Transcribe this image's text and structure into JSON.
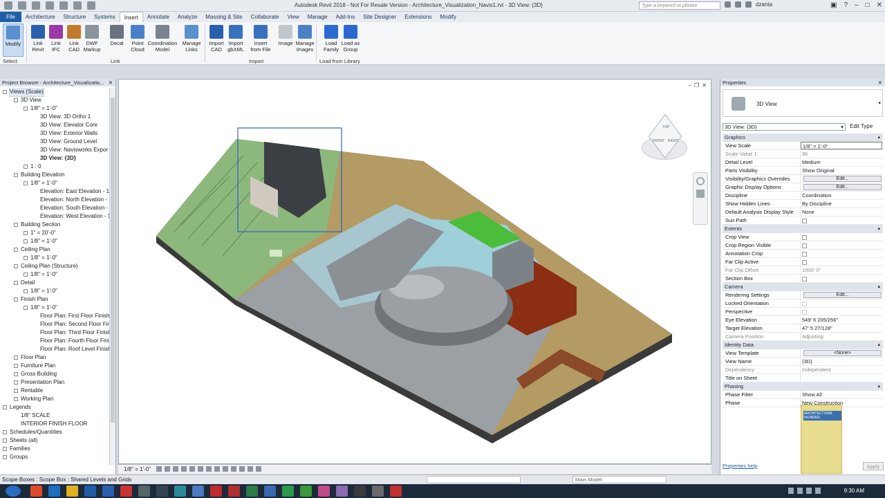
{
  "window": {
    "title": "Autodesk Revit 2018 - Not For Resale Version -    Architecture_Visualization_Navis1.rvt - 3D View: {3D}",
    "search_placeholder": "Type a keyword or phrase",
    "user": "dzanta"
  },
  "tabs": [
    "File",
    "Architecture",
    "Structure",
    "Systems",
    "Insert",
    "Annotate",
    "Analyze",
    "Massing & Site",
    "Collaborate",
    "View",
    "Manage",
    "Add-Ins",
    "Site Designer",
    "Extensions",
    "Modify"
  ],
  "active_tab": "Insert",
  "ribbon": {
    "buttons": [
      {
        "label": "Modify",
        "color": "#5a8fd0"
      },
      {
        "label": "Link\nRevit",
        "color": "#2a5fb0"
      },
      {
        "label": "Link\nIFC",
        "color": "#9a3aa8"
      },
      {
        "label": "Link\nCAD",
        "color": "#c07a2a"
      },
      {
        "label": "DWF\nMarkup",
        "color": "#8a949e"
      },
      {
        "label": "Decal",
        "color": "#6a7480"
      },
      {
        "label": "Point\nCloud",
        "color": "#4a80c8"
      },
      {
        "label": "Coordination\nModel",
        "color": "#7a8490"
      },
      {
        "label": "Manage\nLinks",
        "color": "#5a8fd0"
      },
      {
        "label": "Import\nCAD",
        "color": "#2a5fb0"
      },
      {
        "label": "Import\ngbXML",
        "color": "#3a70c0"
      },
      {
        "label": "Insert\nfrom File",
        "color": "#3a70c0"
      },
      {
        "label": "Image",
        "color": "#c0c6cc"
      },
      {
        "label": "Manage\nImages",
        "color": "#4a80c8"
      },
      {
        "label": "Load\nFamily",
        "color": "#2a6ad0"
      },
      {
        "label": "Load as\nGroup",
        "color": "#2a6ad0"
      }
    ],
    "panels": [
      "Select",
      "Link",
      "Import",
      "Load from Library"
    ]
  },
  "project_browser": {
    "title": "Project Browser - Architecture_Visualizatio...",
    "items": [
      {
        "label": "Views (Scale)",
        "lvl": 0,
        "pm": "-",
        "sel": true
      },
      {
        "label": "3D View",
        "lvl": 1,
        "pm": "-"
      },
      {
        "label": "1/8\" = 1'-0\"",
        "lvl": 2,
        "pm": "-"
      },
      {
        "label": "3D View: 3D Ortho 1",
        "lvl": 3
      },
      {
        "label": "3D View: Elevator Core",
        "lvl": 3
      },
      {
        "label": "3D View: Exterior Walls",
        "lvl": 3
      },
      {
        "label": "3D View: Ground Level",
        "lvl": 3
      },
      {
        "label": "3D View: Navisworks Expor",
        "lvl": 3
      },
      {
        "label": "3D View: {3D}",
        "lvl": 3,
        "bold": true
      },
      {
        "label": "1 : 0",
        "lvl": 2,
        "pm": "+"
      },
      {
        "label": "Building Elevation",
        "lvl": 1,
        "pm": "-"
      },
      {
        "label": "1/8\" = 1'-0\"",
        "lvl": 2,
        "pm": "-"
      },
      {
        "label": "Elevation: East Elevation - 1",
        "lvl": 3
      },
      {
        "label": "Elevation: North Elevation -",
        "lvl": 3
      },
      {
        "label": "Elevation: South Elevation -",
        "lvl": 3
      },
      {
        "label": "Elevation: West Elevation - 1",
        "lvl": 3
      },
      {
        "label": "Building Section",
        "lvl": 1,
        "pm": "-"
      },
      {
        "label": "1\" = 20'-0\"",
        "lvl": 2,
        "pm": "+"
      },
      {
        "label": "1/8\" = 1'-0\"",
        "lvl": 2,
        "pm": "+"
      },
      {
        "label": "Ceiling Plan",
        "lvl": 1,
        "pm": "-"
      },
      {
        "label": "1/8\" = 1'-0\"",
        "lvl": 2,
        "pm": "+"
      },
      {
        "label": "Ceiling Plan (Structure)",
        "lvl": 1,
        "pm": "-"
      },
      {
        "label": "1/8\" = 1'-0\"",
        "lvl": 2,
        "pm": "+"
      },
      {
        "label": "Detail",
        "lvl": 1,
        "pm": "-"
      },
      {
        "label": "1/8\" = 1'-0\"",
        "lvl": 2,
        "pm": "+"
      },
      {
        "label": "Finish Plan",
        "lvl": 1,
        "pm": "-"
      },
      {
        "label": "1/8\" = 1'-0\"",
        "lvl": 2,
        "pm": "-"
      },
      {
        "label": "Floor Plan: First Floor Finish",
        "lvl": 3
      },
      {
        "label": "Floor Plan: Second Floor Fin",
        "lvl": 3
      },
      {
        "label": "Floor Plan: Third Floor Finish",
        "lvl": 3
      },
      {
        "label": "Floor Plan: Fourth Floor Fini",
        "lvl": 3
      },
      {
        "label": "Floor Plan: Roof Level Finish",
        "lvl": 3
      },
      {
        "label": "Floor Plan",
        "lvl": 1,
        "pm": "+"
      },
      {
        "label": "Furniture Plan",
        "lvl": 1,
        "pm": "+"
      },
      {
        "label": "Gross Building",
        "lvl": 1,
        "pm": "+"
      },
      {
        "label": "Presentation Plan",
        "lvl": 1,
        "pm": "+"
      },
      {
        "label": "Rentable",
        "lvl": 1,
        "pm": "+"
      },
      {
        "label": "Working Plan",
        "lvl": 1,
        "pm": "+"
      },
      {
        "label": "Legends",
        "lvl": 0,
        "pm": "-"
      },
      {
        "label": "1/8\" SCALE",
        "lvl": 1
      },
      {
        "label": "INTERIOR FINISH FLOOR",
        "lvl": 1
      },
      {
        "label": "Schedules/Quantities",
        "lvl": 0,
        "pm": "+"
      },
      {
        "label": "Sheets (all)",
        "lvl": 0,
        "pm": "+"
      },
      {
        "label": "Families",
        "lvl": 0,
        "pm": "+"
      },
      {
        "label": "Groups",
        "lvl": 0,
        "pm": "+"
      }
    ]
  },
  "view": {
    "scale": "1/8\" = 1'-0\"",
    "viewcube": {
      "top": "TOP",
      "front": "FRONT",
      "right": "RIGHT"
    }
  },
  "properties": {
    "title": "Properties",
    "type_name": "3D View",
    "selector": "3D View: {3D}",
    "edit_type": "Edit Type",
    "sections": [
      {
        "name": "Graphics",
        "rows": [
          {
            "k": "View Scale",
            "v": "1/8\" = 1'-0\"",
            "t": "inp"
          },
          {
            "k": "Scale Value    1:",
            "v": "96",
            "t": "dis"
          },
          {
            "k": "Detail Level",
            "v": "Medium"
          },
          {
            "k": "Parts Visibility",
            "v": "Show Original"
          },
          {
            "k": "Visibility/Graphics Overrides",
            "v": "Edit...",
            "t": "btn"
          },
          {
            "k": "Graphic Display Options",
            "v": "Edit...",
            "t": "btn"
          },
          {
            "k": "Discipline",
            "v": "Coordination"
          },
          {
            "k": "Show Hidden Lines",
            "v": "By Discipline"
          },
          {
            "k": "Default Analysis Display Style",
            "v": "None"
          },
          {
            "k": "Sun Path",
            "v": "",
            "t": "cb"
          }
        ]
      },
      {
        "name": "Extents",
        "rows": [
          {
            "k": "Crop View",
            "v": "",
            "t": "cb"
          },
          {
            "k": "Crop Region Visible",
            "v": "",
            "t": "cb"
          },
          {
            "k": "Annotation Crop",
            "v": "",
            "t": "cb"
          },
          {
            "k": "Far Clip Active",
            "v": "",
            "t": "cb"
          },
          {
            "k": "Far Clip Offset",
            "v": "1000'  0\"",
            "t": "dis"
          },
          {
            "k": "Section Box",
            "v": "",
            "t": "cb"
          }
        ]
      },
      {
        "name": "Camera",
        "rows": [
          {
            "k": "Rendering Settings",
            "v": "Edit...",
            "t": "btn"
          },
          {
            "k": "Locked Orientation",
            "v": "",
            "t": "cbd"
          },
          {
            "k": "Perspective",
            "v": "",
            "t": "cbd"
          },
          {
            "k": "Eye Elevation",
            "v": "549'  6 205/256\""
          },
          {
            "k": "Target Elevation",
            "v": "47'  5 27/128\""
          },
          {
            "k": "Camera Position",
            "v": "Adjusting",
            "t": "dis"
          }
        ]
      },
      {
        "name": "Identity Data",
        "rows": [
          {
            "k": "View Template",
            "v": "<None>",
            "t": "btn"
          },
          {
            "k": "View Name",
            "v": "{3D}"
          },
          {
            "k": "Dependency",
            "v": "Independent",
            "t": "dis"
          },
          {
            "k": "Title on Sheet",
            "v": ""
          }
        ]
      },
      {
        "name": "Phasing",
        "rows": [
          {
            "k": "Phase Filter",
            "v": "Show All"
          },
          {
            "k": "Phase",
            "v": "New Construction"
          }
        ]
      }
    ],
    "help": "Properties help",
    "apply": "Apply"
  },
  "statusbar": {
    "message": "Scope Boxes : Scope Box : Shared Levels and Grids",
    "model": "Main Model"
  },
  "ad": {
    "tag": "ARCHITECTURAL WONDER"
  },
  "taskbar": {
    "time": "9:30 AM"
  }
}
